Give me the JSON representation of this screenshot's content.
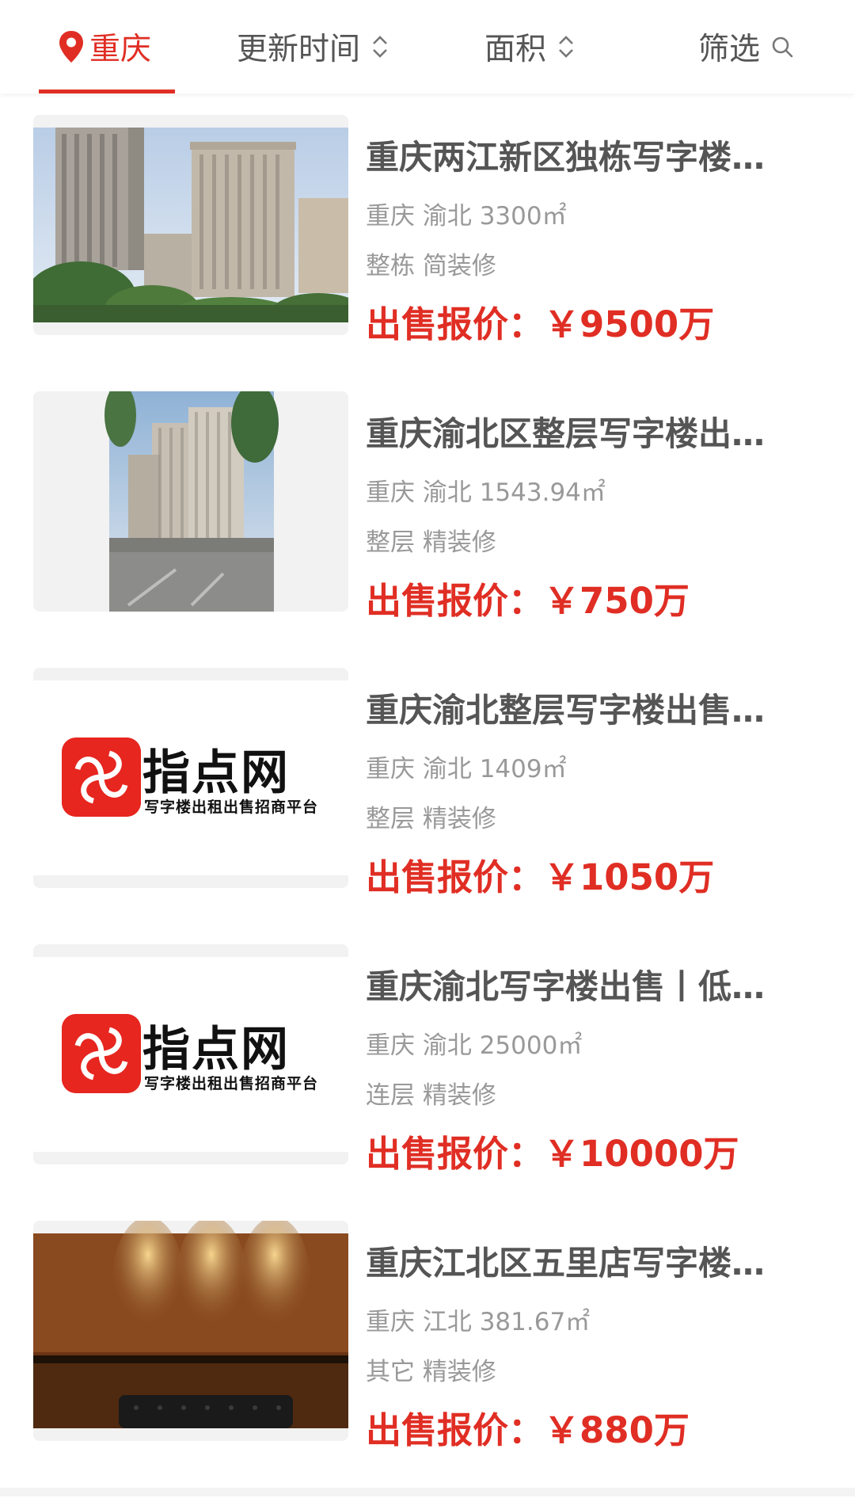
{
  "filter_bar": {
    "city": "重庆",
    "sort_time": "更新时间",
    "sort_area": "面积",
    "filter": "筛选",
    "icons": {
      "city": "location-pin-icon",
      "sort": "sort-updown-icon",
      "filter": "search-icon"
    },
    "accent_color": "#e02e24"
  },
  "listings": [
    {
      "title": "重庆两江新区独栋写字楼…",
      "location": "重庆 渝北 3300㎡",
      "type": "整栋 简装修",
      "price": "出售报价：￥9500万",
      "image": "office-towers-photo"
    },
    {
      "title": "重庆渝北区整层写字楼出…",
      "location": "重庆 渝北 1543.94㎡",
      "type": "整层 精装修",
      "price": "出售报价：￥750万",
      "image": "office-tower-street-photo"
    },
    {
      "title": "重庆渝北整层写字楼出售…",
      "location": "重庆 渝北 1409㎡",
      "type": "整层 精装修",
      "price": "出售报价：￥1050万",
      "image": "brand-logo",
      "logo_name": "指点网",
      "logo_sub": "写字楼出租出售招商平台"
    },
    {
      "title": "重庆渝北写字楼出售丨低…",
      "location": "重庆 渝北 25000㎡",
      "type": "连层 精装修",
      "price": "出售报价：￥10000万",
      "image": "brand-logo",
      "logo_name": "指点网",
      "logo_sub": "写字楼出租出售招商平台"
    },
    {
      "title": "重庆江北区五里店写字楼…",
      "location": "重庆 江北 381.67㎡",
      "type": "其它 精装修",
      "price": "出售报价：￥880万",
      "image": "interior-sofa-photo"
    }
  ]
}
